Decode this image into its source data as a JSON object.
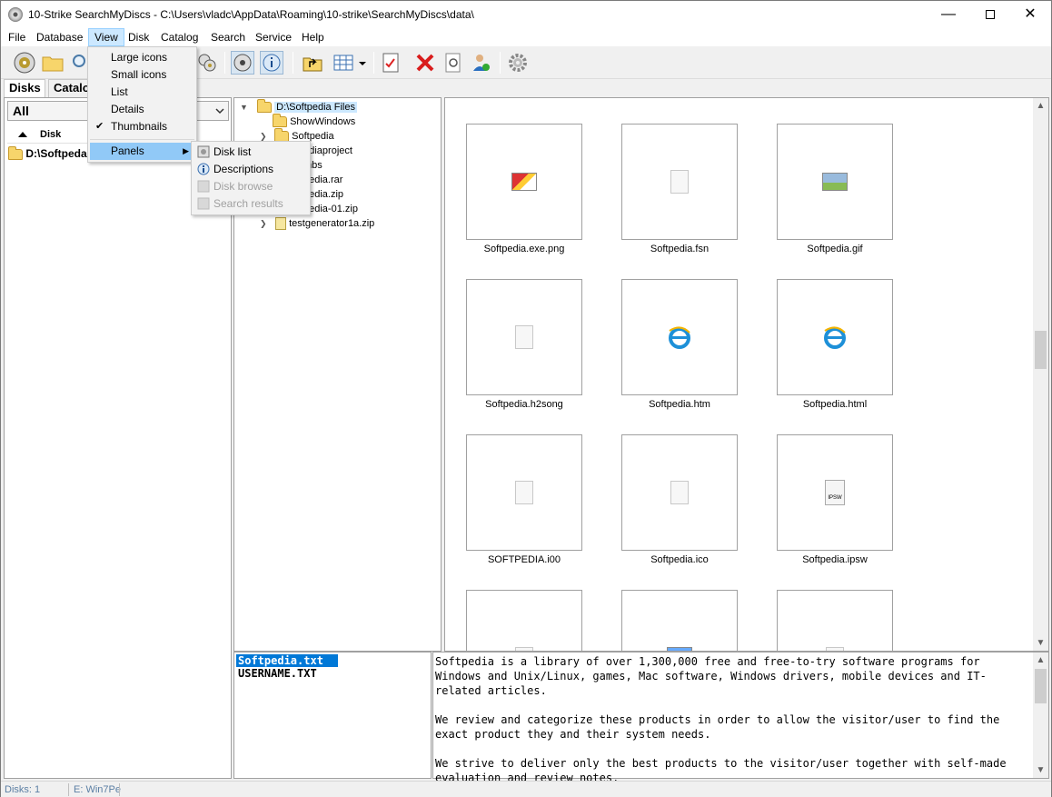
{
  "window": {
    "title": "10-Strike SearchMyDiscs - C:\\Users\\vladc\\AppData\\Roaming\\10-strike\\SearchMyDiscs\\data\\",
    "min_glyph": "—",
    "close_glyph": "✕"
  },
  "menubar": {
    "items": [
      "File",
      "Database",
      "View",
      "Disk",
      "Catalog",
      "Search",
      "Service",
      "Help"
    ]
  },
  "view_menu": {
    "items": [
      "Large icons",
      "Small icons",
      "List",
      "Details",
      "Thumbnails"
    ],
    "checked_glyph": "✔",
    "panels": "Panels",
    "submenu_glyph": "▶"
  },
  "panels_menu": {
    "items": [
      {
        "label": "Disk list",
        "enabled": true
      },
      {
        "label": "Descriptions",
        "enabled": true
      },
      {
        "label": "Disk browse",
        "enabled": false
      },
      {
        "label": "Search results",
        "enabled": false
      }
    ]
  },
  "left_panel": {
    "tabs": [
      "Disks",
      "Catalo"
    ],
    "filter_value": "All",
    "column_header": "Disk",
    "disks": [
      "D:\\Softpeda"
    ]
  },
  "tree": {
    "root": "D:\\Softpedia Files",
    "children": [
      "ShowWindows",
      "Softpedia",
      "pediaproject",
      "mbs",
      "pedia.rar",
      "pedia.zip",
      "pedia-01.zip",
      "testgenerator1a.zip"
    ]
  },
  "thumbnails": {
    "items": [
      {
        "name": "Softpedia.exe.png",
        "icon": "image-icon"
      },
      {
        "name": "Softpedia.fsn",
        "icon": "document-icon"
      },
      {
        "name": "Softpedia.gif",
        "icon": "gif-icon"
      },
      {
        "name": "Softpedia.h2song",
        "icon": "document-icon"
      },
      {
        "name": "Softpedia.htm",
        "icon": "ie-icon"
      },
      {
        "name": "Softpedia.html",
        "icon": "ie-icon"
      },
      {
        "name": "SOFTPEDIA.i00",
        "icon": "document-icon"
      },
      {
        "name": "Softpedia.ico",
        "icon": "document-icon"
      },
      {
        "name": "Softpedia.ipsw",
        "icon": "ipsw-icon"
      }
    ],
    "ipsw_badge": "IPSW",
    "scroll_fraction": 0.45
  },
  "descriptions": {
    "files": [
      "Softpedia.txt",
      "USERNAME.TXT"
    ],
    "text": "Softpedia is a library of over 1,300,000 free and free-to-try software programs for Windows and Unix/Linux, games, Mac software, Windows drivers, mobile devices and IT-related articles.\n\nWe review and categorize these products in order to allow the visitor/user to find the exact product they and their system needs.\n\nWe strive to deliver only the best products to the visitor/user together with self-made evaluation and review notes."
  },
  "statusbar": {
    "disks": "Disks: 1",
    "drive": "E: Win7Pe"
  },
  "colors": {
    "selection": "#0078d7",
    "menu_highlight": "#91c9f7",
    "active_menu": "#cce8ff"
  }
}
